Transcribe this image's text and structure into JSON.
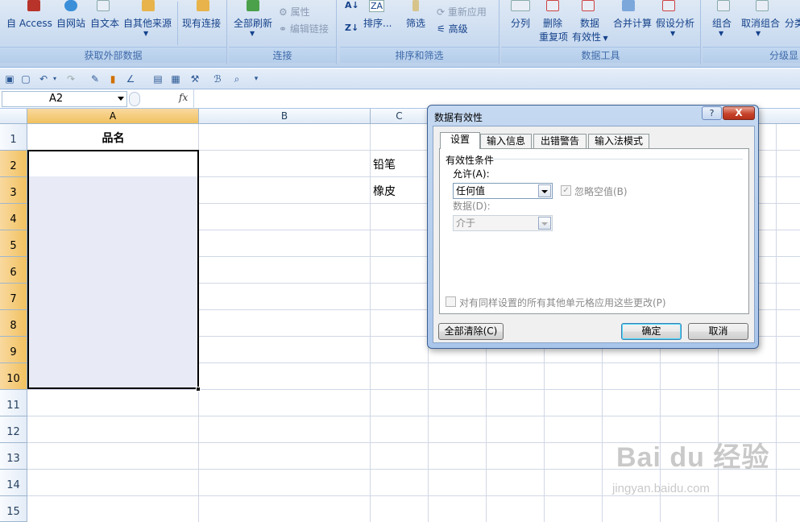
{
  "ribbon": {
    "groups": {
      "external": {
        "title": "获取外部数据",
        "access": "自 Access",
        "web": "自网站",
        "text": "自文本",
        "other": "自其他来源",
        "existing": "现有连接"
      },
      "connections": {
        "title": "连接",
        "refresh_all": "全部刷新",
        "properties": "属性",
        "edit_links": "编辑链接"
      },
      "sort_filter": {
        "title": "排序和筛选",
        "sort": "排序...",
        "filter": "筛选",
        "reapply": "重新应用",
        "advanced": "高级"
      },
      "data_tools": {
        "title": "数据工具",
        "text_to_columns": "分列",
        "remove_duplicates_1": "删除",
        "remove_duplicates_2": "重复项",
        "validation_1": "数据",
        "validation_2": "有效性",
        "consolidate": "合并计算",
        "what_if": "假设分析"
      },
      "outline": {
        "title": "分级显",
        "group": "组合",
        "ungroup": "取消组合",
        "subtotal": "分类"
      }
    }
  },
  "formula_bar": {
    "name_box": "A2",
    "fx": "fx"
  },
  "sheet": {
    "columns": [
      "A",
      "B",
      "C"
    ],
    "rows": [
      "1",
      "2",
      "3",
      "4",
      "5",
      "6",
      "7",
      "8",
      "9",
      "10",
      "11",
      "12",
      "13",
      "14",
      "15"
    ],
    "cells": {
      "A1": "品名",
      "C2": "铅笔",
      "C3": "橡皮"
    }
  },
  "dialog": {
    "title": "数据有效性",
    "help": "?",
    "close": "X",
    "tabs": [
      "设置",
      "输入信息",
      "出错警告",
      "输入法模式"
    ],
    "section": "有效性条件",
    "allow_label": "允许(A):",
    "allow_value": "任何值",
    "ignore_blank": "忽略空值(B)",
    "data_label": "数据(D):",
    "data_value": "介于",
    "apply_all": "对有同样设置的所有其他单元格应用这些更改(P)",
    "clear_all": "全部清除(C)",
    "ok": "确定",
    "cancel": "取消"
  },
  "watermark": {
    "brand": "Bai du 经验",
    "url": "jingyan.baidu.com"
  }
}
